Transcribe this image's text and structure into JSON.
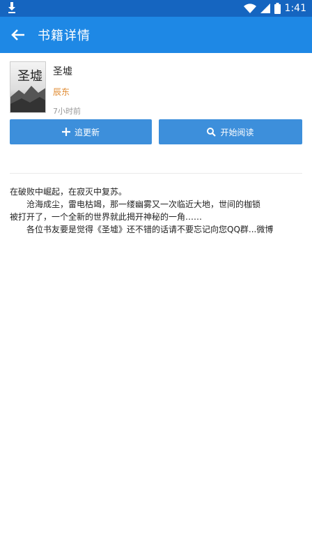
{
  "status_bar": {
    "time": "1:41",
    "icons": [
      "download-icon",
      "wifi-icon",
      "signal-icon",
      "battery-icon"
    ]
  },
  "app_bar": {
    "title": "书籍详情",
    "back_icon": "arrow-left-icon"
  },
  "book": {
    "title": "圣墟",
    "author": "辰东",
    "updated": "7小时前",
    "cover_text": "圣墟"
  },
  "actions": {
    "follow_label": "追更新",
    "follow_icon": "plus-icon",
    "read_label": "开始阅读",
    "read_icon": "search-icon"
  },
  "intro": {
    "line1": "在破败中崛起，在寂灭中复苏。",
    "line2": "沧海成尘，雷电枯竭，那一缕幽雾又一次临近大地，世间的枷锁",
    "line3": "被打开了，一个全新的世界就此揭开神秘的一角……",
    "line4": "各位书友要是觉得《圣墟》还不错的话请不要忘记向您QQ群...微博"
  },
  "colors": {
    "status_bar": "#1565c0",
    "app_bar": "#1e88e5",
    "button": "#3d8fdb",
    "author": "#e08a30"
  }
}
